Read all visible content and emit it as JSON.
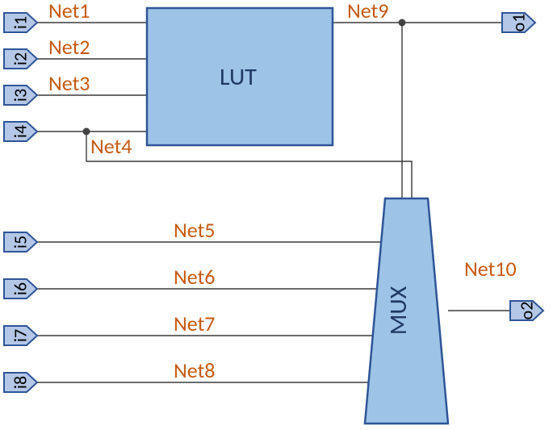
{
  "diagram": {
    "inputs": {
      "i1": "i1",
      "i2": "i2",
      "i3": "i3",
      "i4": "i4",
      "i5": "i5",
      "i6": "i6",
      "i7": "i7",
      "i8": "i8"
    },
    "outputs": {
      "o1": "o1",
      "o2": "o2"
    },
    "nets": {
      "n1": "Net1",
      "n2": "Net2",
      "n3": "Net3",
      "n4": "Net4",
      "n5": "Net5",
      "n6": "Net6",
      "n7": "Net7",
      "n8": "Net8",
      "n9": "Net9",
      "n10": "Net10"
    },
    "blocks": {
      "lut": "LUT",
      "mux": "MUX"
    },
    "colors": {
      "port_fill": "#b4c7e7",
      "port_stroke": "#2f5597",
      "block_fill": "#9dc3e6",
      "block_stroke": "#2f5597",
      "net_text": "#c65911",
      "block_text": "#1f3864",
      "wire": "#3a3a3a"
    }
  },
  "chart_data": {
    "type": "diagram",
    "title": "Logic circuit block diagram with LUT and MUX",
    "inputs": [
      "i1",
      "i2",
      "i3",
      "i4",
      "i5",
      "i6",
      "i7",
      "i8"
    ],
    "outputs": [
      "o1",
      "o2"
    ],
    "blocks": [
      {
        "name": "LUT",
        "inputs": [
          "Net1",
          "Net2",
          "Net3",
          "Net4"
        ],
        "outputs": [
          "Net9"
        ]
      },
      {
        "name": "MUX",
        "inputs": [
          "Net4",
          "Net5",
          "Net6",
          "Net7",
          "Net8",
          "Net9"
        ],
        "outputs": [
          "Net10"
        ]
      }
    ],
    "nets": [
      {
        "name": "Net1",
        "from": "i1",
        "to": "LUT"
      },
      {
        "name": "Net2",
        "from": "i2",
        "to": "LUT"
      },
      {
        "name": "Net3",
        "from": "i3",
        "to": "LUT"
      },
      {
        "name": "Net4",
        "from": "i4",
        "to": [
          "LUT",
          "MUX"
        ]
      },
      {
        "name": "Net5",
        "from": "i5",
        "to": "MUX"
      },
      {
        "name": "Net6",
        "from": "i6",
        "to": "MUX"
      },
      {
        "name": "Net7",
        "from": "i7",
        "to": "MUX"
      },
      {
        "name": "Net8",
        "from": "i8",
        "to": "MUX"
      },
      {
        "name": "Net9",
        "from": "LUT",
        "to": [
          "o1",
          "MUX"
        ]
      },
      {
        "name": "Net10",
        "from": "MUX",
        "to": "o2"
      }
    ]
  }
}
